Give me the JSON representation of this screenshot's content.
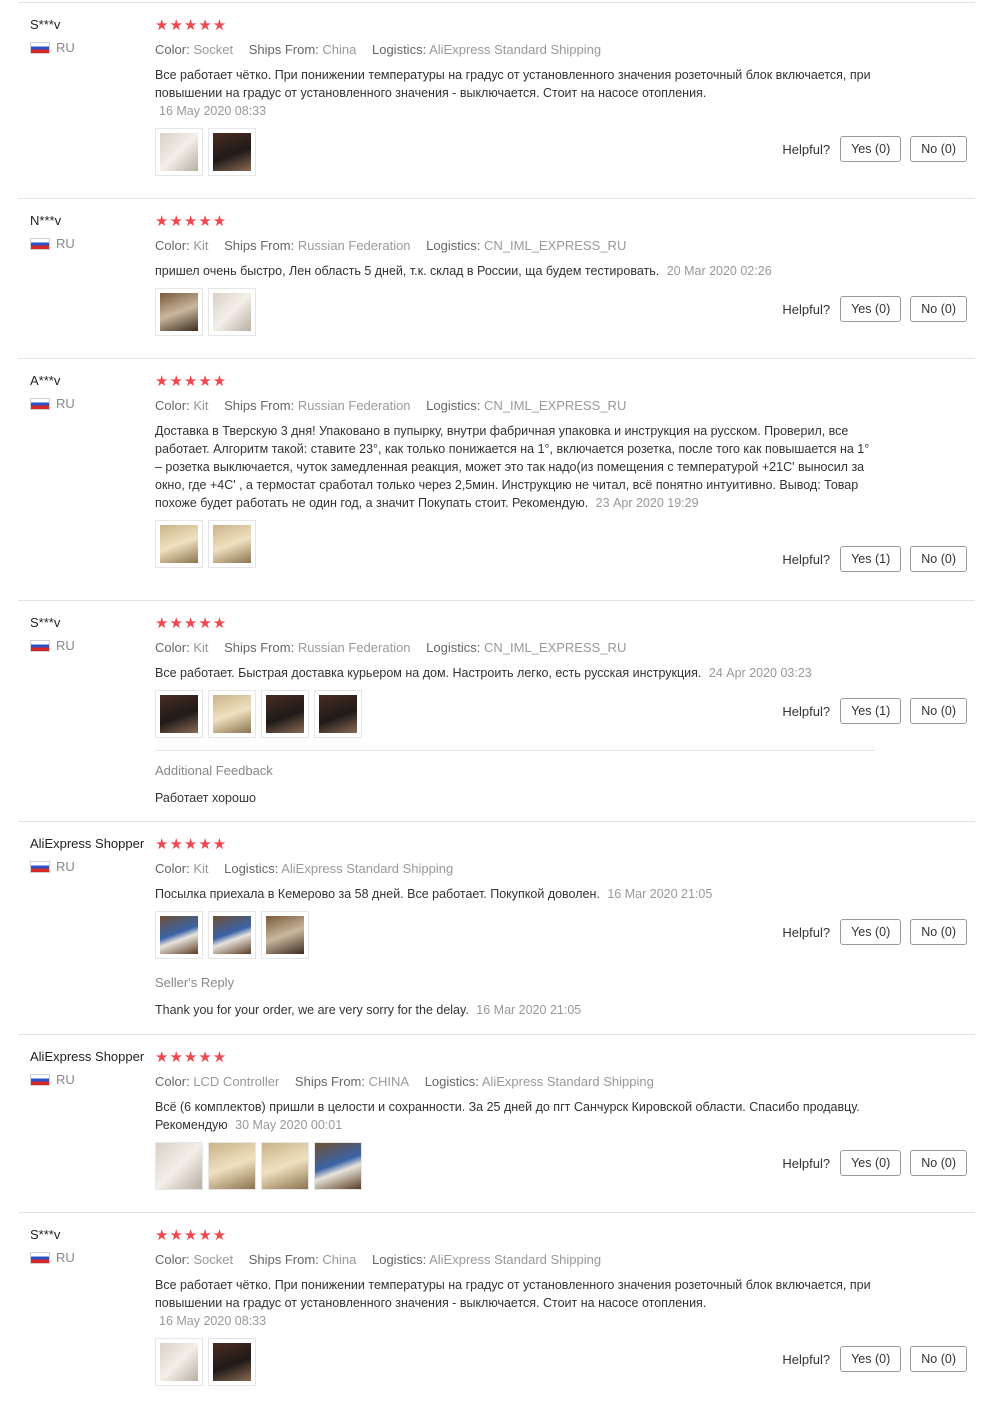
{
  "helpful_label": "Helpful?",
  "stars": "★★★★★",
  "reviews": [
    {
      "user": "S***v",
      "country": "RU",
      "attrs": [
        {
          "k": "Color:",
          "v": "Socket"
        },
        {
          "k": "Ships From:",
          "v": "China"
        },
        {
          "k": "Logistics:",
          "v": "AliExpress Standard Shipping"
        }
      ],
      "text": "Все работает чётко. При понижении температуры на градус от установленного значения розеточный блок включается, при повышении на градус от установленного значения - выключается. Стоит на насосе отопления.",
      "date": "16 May 2020 08:33",
      "yes": "Yes (0)",
      "no": "No (0)"
    },
    {
      "user": "N***v",
      "country": "RU",
      "attrs": [
        {
          "k": "Color:",
          "v": "Kit"
        },
        {
          "k": "Ships From:",
          "v": "Russian Federation"
        },
        {
          "k": "Logistics:",
          "v": "CN_IML_EXPRESS_RU"
        }
      ],
      "text": "пришел очень быстро, Лен область 5 дней, т.к. склад в России, ща будем тестировать.",
      "date": "20 Mar 2020 02:26",
      "yes": "Yes (0)",
      "no": "No (0)"
    },
    {
      "user": "A***v",
      "country": "RU",
      "attrs": [
        {
          "k": "Color:",
          "v": "Kit"
        },
        {
          "k": "Ships From:",
          "v": "Russian Federation"
        },
        {
          "k": "Logistics:",
          "v": "CN_IML_EXPRESS_RU"
        }
      ],
      "text": "Доставка в Тверскую 3 дня! Упаковано в пупырку, внутри фабричная упаковка и инструкция на русском. Проверил, все работает. Алгоритм такой: ставите 23°, как только понижается на 1°, включается розетка, после того как повышается на 1° – розетка выключается, чуток замедленная реакция, может это так надо(из помещения с температурой +21С' выносил за окно, где +4С' , а термостат сработал только через 2,5мин. Инструкцию не читал, всё понятно интуитивно. Вывод: Товар похоже будет работать не один год, а значит Покупать стоит. Рекомендую.",
      "date": "23 Apr 2020 19:29",
      "yes": "Yes (1)",
      "no": "No (0)"
    },
    {
      "user": "S***v",
      "country": "RU",
      "attrs": [
        {
          "k": "Color:",
          "v": "Kit"
        },
        {
          "k": "Ships From:",
          "v": "Russian Federation"
        },
        {
          "k": "Logistics:",
          "v": "CN_IML_EXPRESS_RU"
        }
      ],
      "text": "Все работает. Быстрая доставка курьером на дом. Настроить легко, есть русская инструкция.",
      "date": "24 Apr 2020 03:23",
      "yes": "Yes (1)",
      "no": "No (0)",
      "additional_title": "Additional Feedback",
      "additional_text": "Работает хорошо"
    },
    {
      "user": "AliExpress Shopper",
      "country": "RU",
      "attrs": [
        {
          "k": "Color:",
          "v": "Kit"
        },
        {
          "k": "Logistics:",
          "v": "AliExpress Standard Shipping"
        }
      ],
      "text": "Посылка приехала в Кемерово за 58 дней. Все работает. Покупкой доволен.",
      "date": "16 Mar 2020 21:05",
      "yes": "Yes (0)",
      "no": "No (0)",
      "reply_title": "Seller's Reply",
      "reply_text": "Thank you for your order, we are very sorry for the delay.",
      "reply_date": "16 Mar 2020 21:05"
    },
    {
      "user": "AliExpress Shopper",
      "country": "RU",
      "attrs": [
        {
          "k": "Color:",
          "v": "LCD Controller"
        },
        {
          "k": "Ships From:",
          "v": "CHINA"
        },
        {
          "k": "Logistics:",
          "v": "AliExpress Standard Shipping"
        }
      ],
      "text": "Всё (6 комплектов) пришли в целости и сохранности. За 25 дней до пгт Санчурск Кировской области. Спасибо продавцу. Рекомендую",
      "date": "30 May 2020 00:01",
      "yes": "Yes (0)",
      "no": "No (0)"
    },
    {
      "user": "S***v",
      "country": "RU",
      "attrs": [
        {
          "k": "Color:",
          "v": "Socket"
        },
        {
          "k": "Ships From:",
          "v": "China"
        },
        {
          "k": "Logistics:",
          "v": "AliExpress Standard Shipping"
        }
      ],
      "text": "Все работает чётко. При понижении температуры на градус от установленного значения розеточный блок включается, при повышении на градус от установленного значения - выключается. Стоит на насосе отопления.",
      "date": "16 May 2020 08:33",
      "yes": "Yes (0)",
      "no": "No (0)"
    }
  ]
}
